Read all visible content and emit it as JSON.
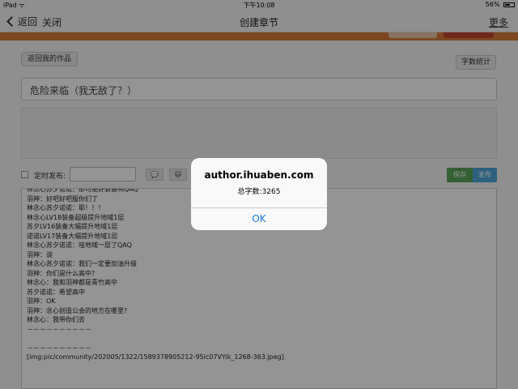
{
  "statusbar": {
    "device": "iPad",
    "wifi": "ᯤ",
    "time": "下午10:08",
    "battery": "56%"
  },
  "navbar": {
    "back_label": "返回",
    "close_label": "关闭",
    "title": "创建章节",
    "more_label": "更多"
  },
  "toolbar": {
    "back_to_works": "返回我的作品",
    "word_count": "字数统计",
    "schedule_label": "定时发布:",
    "save": "保存",
    "publish": "发布",
    "emoji_icon": "💬",
    "cat_icon": "🐱"
  },
  "chapter": {
    "title": "危险来临（我无敌了？）"
  },
  "editor": {
    "lines": [
      "林念心苏夕诺诺：那可是好装备啊QAQ",
      "羽神：好吧好吧服你们了",
      "林念心苏夕诺诺：耶！！！",
      "林念心LV18装备超级提升地域1层",
      "苏夕LV16装备大幅提升地域1层",
      "诺诺LV17装备大幅提升地域1层",
      "林念心苏夕诺诺：哇地域一层了QAQ",
      "羽神：谈",
      "林念心苏夕诺诺：我们一定要加油升级",
      "羽神：你们是什么高中?",
      "林念心：我和羽神都是青竹高中",
      "苏夕诺诺：希望高中",
      "羽神：OK",
      "羽神：念心创造公会的地方在哪里?",
      "林念心：我带你们去",
      "－－－－－－－－－－",
      "",
      "－－－－－－－－－－",
      "[img:pic/community/202005/1322/1589378905212-95ic07VYik_1268-363.jpeg]"
    ]
  },
  "alert": {
    "title": "author.ihuaben.com",
    "message": "总字数:3265",
    "ok_label": "OK"
  }
}
